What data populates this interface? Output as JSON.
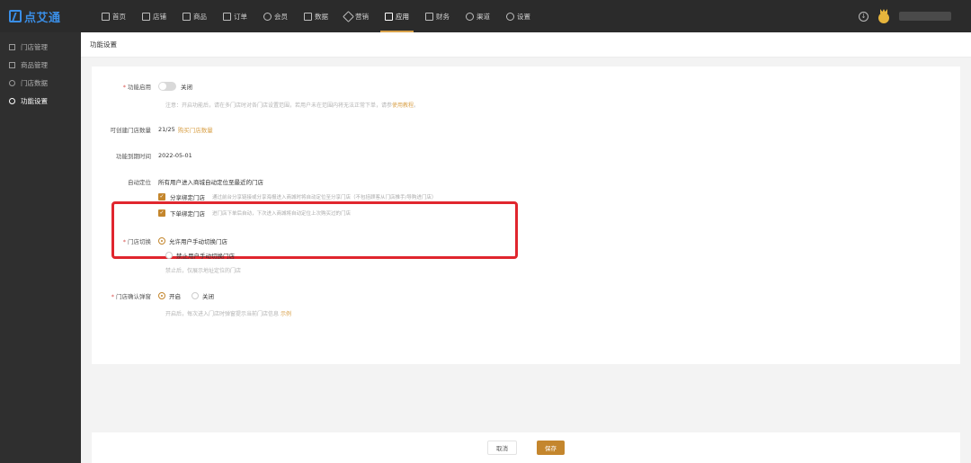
{
  "brand": {
    "logo_text": "点艾通"
  },
  "nav": [
    {
      "label": "首页",
      "icon": "home-icon"
    },
    {
      "label": "店铺",
      "icon": "shop-icon"
    },
    {
      "label": "商品",
      "icon": "goods-icon"
    },
    {
      "label": "订单",
      "icon": "order-icon"
    },
    {
      "label": "会员",
      "icon": "member-icon"
    },
    {
      "label": "数据",
      "icon": "data-icon"
    },
    {
      "label": "营销",
      "icon": "tag-icon"
    },
    {
      "label": "应用",
      "icon": "app-icon"
    },
    {
      "label": "财务",
      "icon": "finance-icon"
    },
    {
      "label": "渠道",
      "icon": "channel-icon"
    },
    {
      "label": "设置",
      "icon": "settings-icon"
    }
  ],
  "sidebar": {
    "items": [
      {
        "label": "门店管理"
      },
      {
        "label": "商品管理"
      },
      {
        "label": "门店数据"
      },
      {
        "label": "功能设置"
      }
    ]
  },
  "page": {
    "title": "功能设置"
  },
  "form": {
    "enable": {
      "label": "功能启用",
      "toggle_text": "关闭",
      "hint": "注意：开启功能后，请在多门店时对各门店设置范围，若用户未在范围内将无法正常下单，请参",
      "hint_link": "使用教程",
      "hint_end": "。"
    },
    "store_count": {
      "label": "可创建门店数量",
      "value": "21/25",
      "link": "购买门店数量"
    },
    "expire": {
      "label": "功能到期时间",
      "value": "2022-05-01"
    },
    "auto_locate": {
      "label": "自动定位",
      "desc": "所有用户进入商城自动定位至最近的门店",
      "opt1_label": "分享绑定门店",
      "opt1_hint": "通过前台分享链接或分享海报进入商城时将自动定位至分享门店（不包括顾客从门店推手/导购进门店）",
      "opt2_label": "下单绑定门店",
      "opt2_hint": "进门店下单后自动，下次进入商城将自动定位上次购买过的门店"
    },
    "switch_store": {
      "label": "门店切换",
      "opt1": "允许用户手动切换门店",
      "opt2": "禁止用户手动切换门店",
      "hint": "禁止后，仅展示地址定位的门店"
    },
    "confirm_popup": {
      "label": "门店确认弹窗",
      "on": "开启",
      "off": "关闭",
      "hint": "开启后，每次进入门店时弹窗提示当前门店信息",
      "hint_link": "示例"
    }
  },
  "footer": {
    "cancel": "取消",
    "save": "保存"
  },
  "colors": {
    "accent": "#c4862d",
    "highlight": "#e0262e",
    "topbar": "#2b2b2b",
    "logo": "#3a8ee6"
  }
}
